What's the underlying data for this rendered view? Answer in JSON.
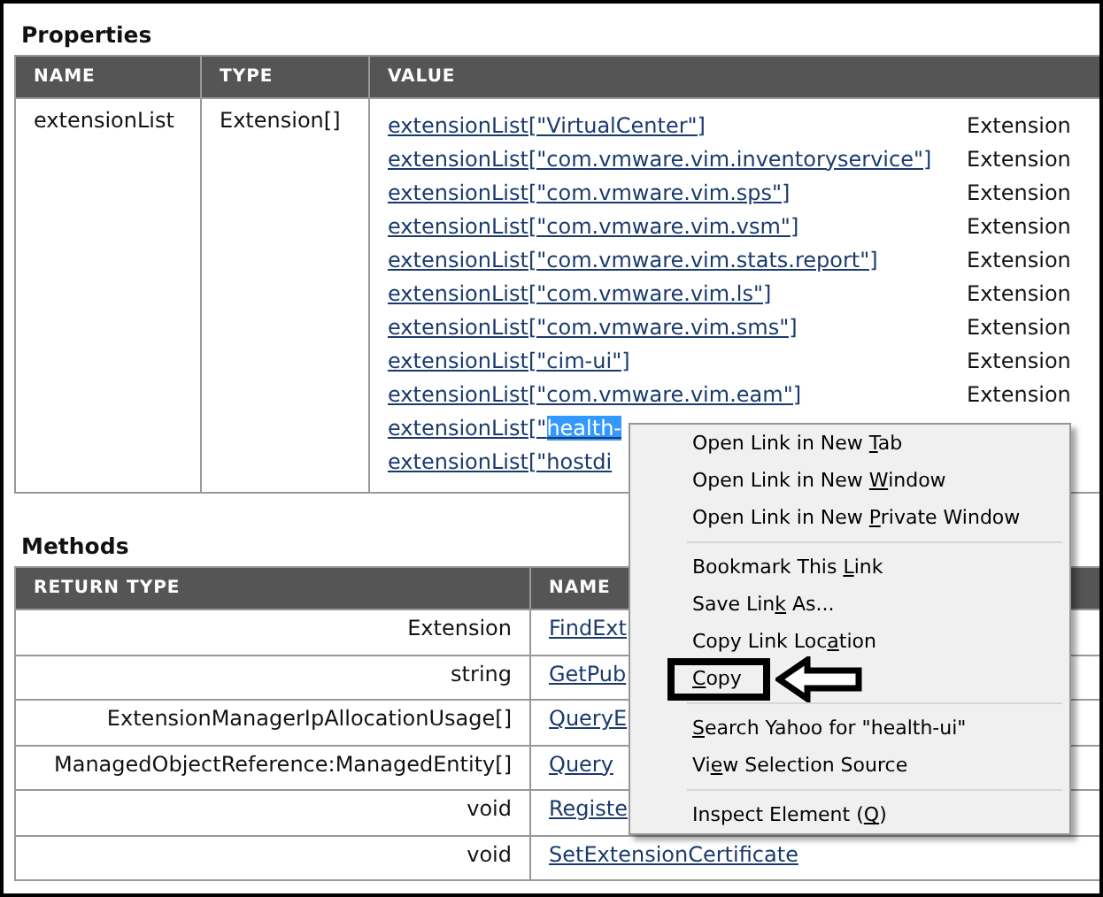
{
  "properties": {
    "title": "Properties",
    "columns": [
      "NAME",
      "TYPE",
      "VALUE"
    ],
    "rows": [
      {
        "name": "extensionList",
        "type": "Extension[]",
        "values": [
          {
            "link": "extensionList[\"VirtualCenter\"]",
            "type": "Extension"
          },
          {
            "link": "extensionList[\"com.vmware.vim.inventoryservice\"]",
            "type": "Extension"
          },
          {
            "link": "extensionList[\"com.vmware.vim.sps\"]",
            "type": "Extension"
          },
          {
            "link": "extensionList[\"com.vmware.vim.vsm\"]",
            "type": "Extension"
          },
          {
            "link": "extensionList[\"com.vmware.vim.stats.report\"]",
            "type": "Extension"
          },
          {
            "link": "extensionList[\"com.vmware.vim.ls\"]",
            "type": "Extension"
          },
          {
            "link": "extensionList[\"com.vmware.vim.sms\"]",
            "type": "Extension"
          },
          {
            "link": "extensionList[\"cim-ui\"]",
            "type": "Extension"
          },
          {
            "link": "extensionList[\"com.vmware.vim.eam\"]",
            "type": "Extension"
          },
          {
            "link": "extensionList[\"",
            "selection": "health-"
          },
          {
            "link": "extensionList[\"hostdi"
          }
        ]
      }
    ]
  },
  "methods": {
    "title": "Methods",
    "columns": [
      "RETURN TYPE",
      "NAME"
    ],
    "rows": [
      {
        "return_type": "Extension",
        "name": "FindExt"
      },
      {
        "return_type": "string",
        "name": "GetPub"
      },
      {
        "return_type": "ExtensionManagerIpAllocationUsage[]",
        "name": "QueryE"
      },
      {
        "return_type": "ManagedObjectReference:ManagedEntity[]",
        "name": "Query"
      },
      {
        "return_type": "void",
        "name": "Registe"
      },
      {
        "return_type": "void",
        "name": "SetExtensionCertificate"
      }
    ]
  },
  "context_menu": {
    "items": [
      {
        "kind": "item",
        "before": "Open Link in New ",
        "key": "T",
        "after": "ab",
        "annotated": false
      },
      {
        "kind": "item",
        "before": "Open Link in New ",
        "key": "W",
        "after": "indow",
        "annotated": false
      },
      {
        "kind": "item",
        "before": "Open Link in New ",
        "key": "P",
        "after": "rivate Window",
        "annotated": false
      },
      {
        "kind": "separator"
      },
      {
        "kind": "item",
        "before": "Bookmark This ",
        "key": "L",
        "after": "ink",
        "annotated": false
      },
      {
        "kind": "item",
        "before": "Save Lin",
        "key": "k",
        "after": " As...",
        "annotated": false
      },
      {
        "kind": "item",
        "before": "Copy Link Loc",
        "key": "a",
        "after": "tion",
        "annotated": false
      },
      {
        "kind": "item",
        "key": "C",
        "after": "opy",
        "annotated": true
      },
      {
        "kind": "separator"
      },
      {
        "kind": "item",
        "key": "S",
        "after": "earch Yahoo for \"health-ui\"",
        "annotated": false
      },
      {
        "kind": "item",
        "before": "Vi",
        "key": "e",
        "after": "w Selection Source",
        "annotated": false
      },
      {
        "kind": "separator"
      },
      {
        "kind": "item",
        "before": "Inspect Element (",
        "key": "Q",
        "after": ")",
        "annotated": false
      }
    ]
  }
}
